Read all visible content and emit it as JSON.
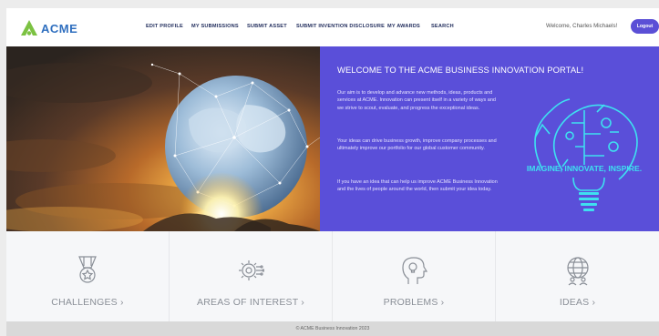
{
  "brand": {
    "name": "ACME",
    "color": "#2f6fbf",
    "mark_color": "#7cc242"
  },
  "nav": {
    "items": [
      {
        "label": "EDIT PROFILE"
      },
      {
        "label": "MY SUBMISSIONS"
      },
      {
        "label": "SUBMIT ASSET"
      },
      {
        "label": "SUBMIT INVENTION DISCLOSURE"
      },
      {
        "label": "MY AWARDS"
      },
      {
        "label": "SEARCH"
      }
    ],
    "welcome": "Welcome, Charles Michaels!",
    "logout_label": "Logout"
  },
  "hero": {
    "title": "WELCOME TO THE ACME BUSINESS INNOVATION PORTAL!",
    "paragraphs": [
      "Our aim is to develop and advance new methods, ideas, products and services at ACME. Innovation can present itself in a variety of ways and we strive to scout, evaluate, and progress the exceptional ideas.",
      "Your ideas can drive business growth, improve company processes and ultimately improve our portfolio for our global customer community.",
      "If you have an idea that can help us improve ACME Business Innovation and the lives of people around the world, then submit your idea today."
    ],
    "art_caption": "IMAGINE, INNOVATE, INSPIRE.",
    "panel_color": "#5a4fd9",
    "art_color": "#3ee0f0"
  },
  "tiles": [
    {
      "label": "CHALLENGES ›",
      "icon": "medal-icon"
    },
    {
      "label": "AREAS OF INTEREST ›",
      "icon": "gear-circuit-icon"
    },
    {
      "label": "PROBLEMS ›",
      "icon": "head-lightbulb-icon"
    },
    {
      "label": "IDEAS ›",
      "icon": "globe-people-icon"
    }
  ],
  "footer": {
    "text": "© ACME Business Innovation 2023"
  }
}
